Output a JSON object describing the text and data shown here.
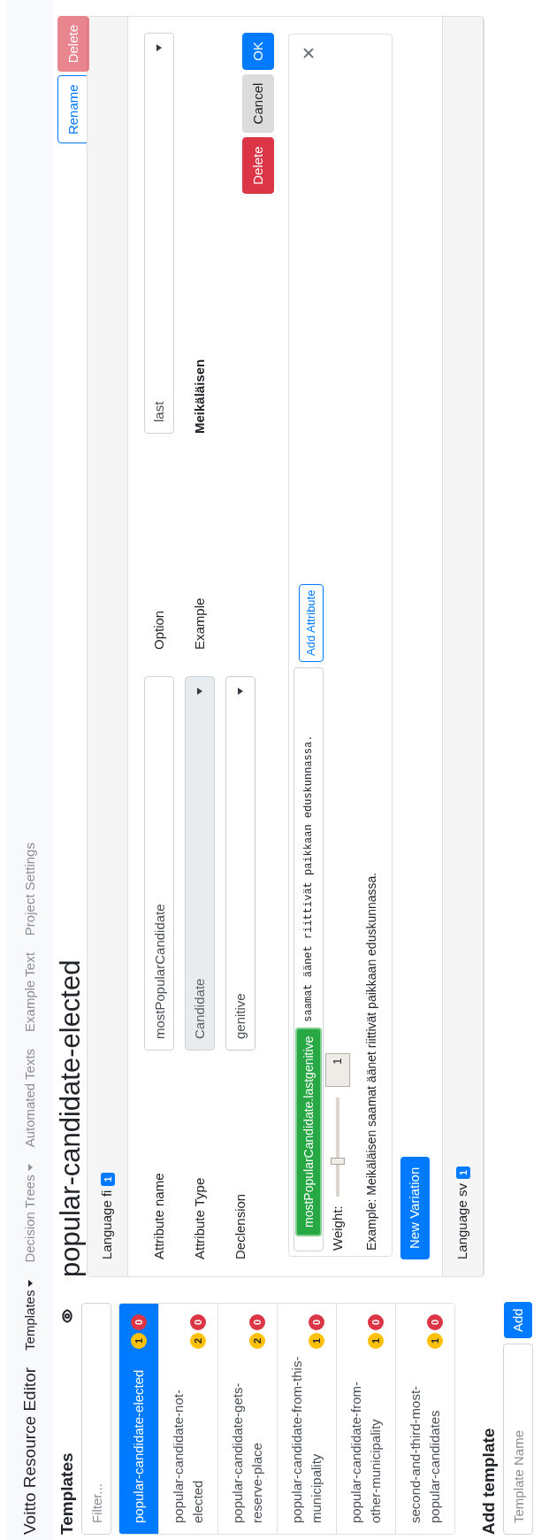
{
  "navbar": {
    "brand": "Voitto Resource Editor",
    "items": [
      {
        "label": "Templates",
        "dropdown": true,
        "selected": true
      },
      {
        "label": "Decision Trees",
        "dropdown": true,
        "selected": false
      },
      {
        "label": "Automated Texts",
        "dropdown": false,
        "selected": false
      },
      {
        "label": "Example Text",
        "dropdown": false,
        "selected": false
      },
      {
        "label": "Project Settings",
        "dropdown": false,
        "selected": false
      }
    ]
  },
  "sidebar": {
    "title": "Templates",
    "filter": {
      "placeholder": "Filter..."
    },
    "templates": [
      {
        "name": "popular-candidate-elected",
        "selected": true,
        "warnings": "1",
        "errors": "0"
      },
      {
        "name": "popular-candidate-not-elected",
        "selected": false,
        "warnings": "2",
        "errors": "0"
      },
      {
        "name": "popular-candidate-gets-reserve-place",
        "selected": false,
        "warnings": "2",
        "errors": "0"
      },
      {
        "name": "popular-candidate-from-this-municipality",
        "selected": false,
        "warnings": "1",
        "errors": "0"
      },
      {
        "name": "popular-candidate-from-other-municipality",
        "selected": false,
        "warnings": "1",
        "errors": "0"
      },
      {
        "name": "second-and-third-most-popular-candidates",
        "selected": false,
        "warnings": "1",
        "errors": "0"
      }
    ],
    "add_template": {
      "title": "Add template",
      "input": {
        "placeholder": "Template Name"
      },
      "button": "Add"
    }
  },
  "main": {
    "title": "popular-candidate-elected",
    "buttons": [
      {
        "label": "Rename",
        "kind": "outline",
        "disabled": false
      },
      {
        "label": "Delete",
        "kind": "danger",
        "disabled": true
      }
    ],
    "languages": [
      {
        "label": "Language fi",
        "count": "1",
        "attribute_editor": {
          "fields": [
            {
              "label": "Attribute name",
              "kind": "text",
              "value": "mostPopularCandidate",
              "disabled": false
            },
            {
              "label": "Attribute Type",
              "kind": "select",
              "value": "Candidate",
              "disabled": true
            },
            {
              "label": "Declension",
              "kind": "select",
              "value": "genitive",
              "disabled": false
            }
          ],
          "option": {
            "label": "Option",
            "value": "last"
          },
          "example": {
            "label": "Example",
            "value": "Meikäläisen"
          },
          "buttons": [
            {
              "label": "Delete",
              "kind": "danger",
              "disabled": false
            },
            {
              "label": "Cancel",
              "kind": "secondary",
              "disabled": false
            },
            {
              "label": "OK",
              "kind": "primary",
              "disabled": false
            }
          ]
        },
        "variation": {
          "tag": "mostPopularCandidate.lastgenitive",
          "text": "saamat äänet riittivät paikkaan eduskunnassa.",
          "add_attribute": "Add Attribute",
          "weight_label": "Weight:",
          "weight": {
            "level": 0.36
          },
          "weight_value": "1",
          "example": "Example: Meikäläisen saamat äänet riittivät paikkaan eduskunnassa."
        },
        "new_variation": "New Variation"
      },
      {
        "label": "Language sv",
        "count": "1"
      }
    ]
  }
}
